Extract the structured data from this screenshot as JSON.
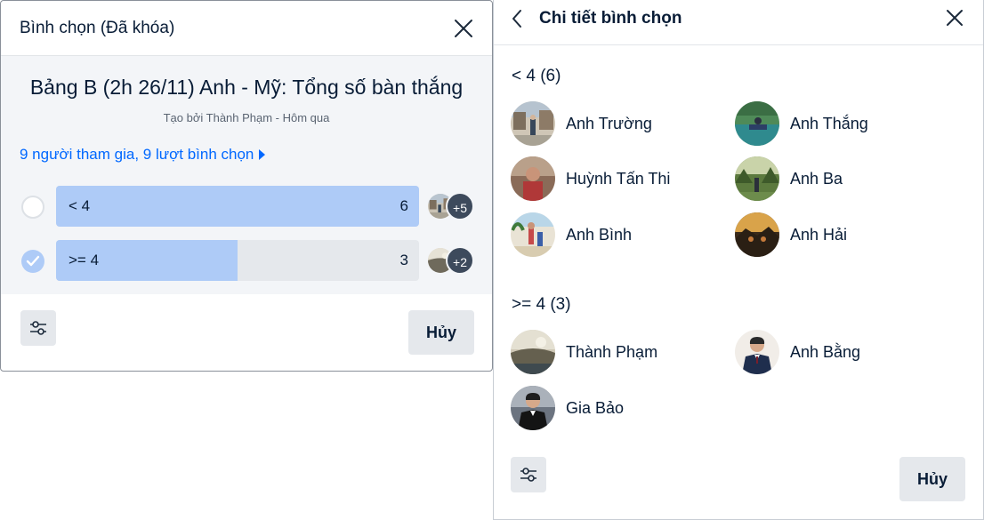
{
  "poll_dialog": {
    "title": "Bình chọn (Đã khóa)",
    "question": "Bảng B (2h 26/11) Anh - Mỹ: Tổng số bàn thắng",
    "meta": "Tạo bởi Thành Phạm - Hôm qua",
    "summary": "9 người tham gia, 9 lượt bình chọn",
    "options": [
      {
        "label": "< 4",
        "count": "6",
        "fraction": 1.0,
        "checked": false,
        "more": "+5"
      },
      {
        "label": ">= 4",
        "count": "3",
        "fraction": 0.5,
        "checked": true,
        "more": "+2"
      }
    ],
    "cancel_label": "Hủy"
  },
  "details_panel": {
    "title": "Chi tiết bình chọn",
    "groups": [
      {
        "title": "< 4 (6)",
        "voters": [
          {
            "name": "Anh Trường",
            "avatar": "town-photo"
          },
          {
            "name": "Anh Thắng",
            "avatar": "lake-boat-photo"
          },
          {
            "name": "Huỳnh Tấn Thi",
            "avatar": "portrait-photo"
          },
          {
            "name": "Anh Ba",
            "avatar": "forest-photo"
          },
          {
            "name": "Anh Bình",
            "avatar": "beach-photo"
          },
          {
            "name": "Anh Hải",
            "avatar": "sunset-photo"
          }
        ]
      },
      {
        "title": ">= 4 (3)",
        "voters": [
          {
            "name": "Thành Phạm",
            "avatar": "landscape-photo"
          },
          {
            "name": "Anh Bằng",
            "avatar": "suit-portrait-photo"
          },
          {
            "name": "Gia Bảo",
            "avatar": "suit-portrait-photo"
          }
        ]
      }
    ],
    "cancel_label": "Hủy"
  },
  "icons": {
    "close": "close-icon",
    "back": "chevron-left-icon",
    "settings": "sliders-icon",
    "check": "check-icon",
    "caret": "caret-right-icon"
  },
  "colors": {
    "link": "#0068ff",
    "bar_fill": "#aecbf7",
    "bar_track": "#e5e8ec",
    "text": "#081c36",
    "badge": "#3d4a5c"
  }
}
